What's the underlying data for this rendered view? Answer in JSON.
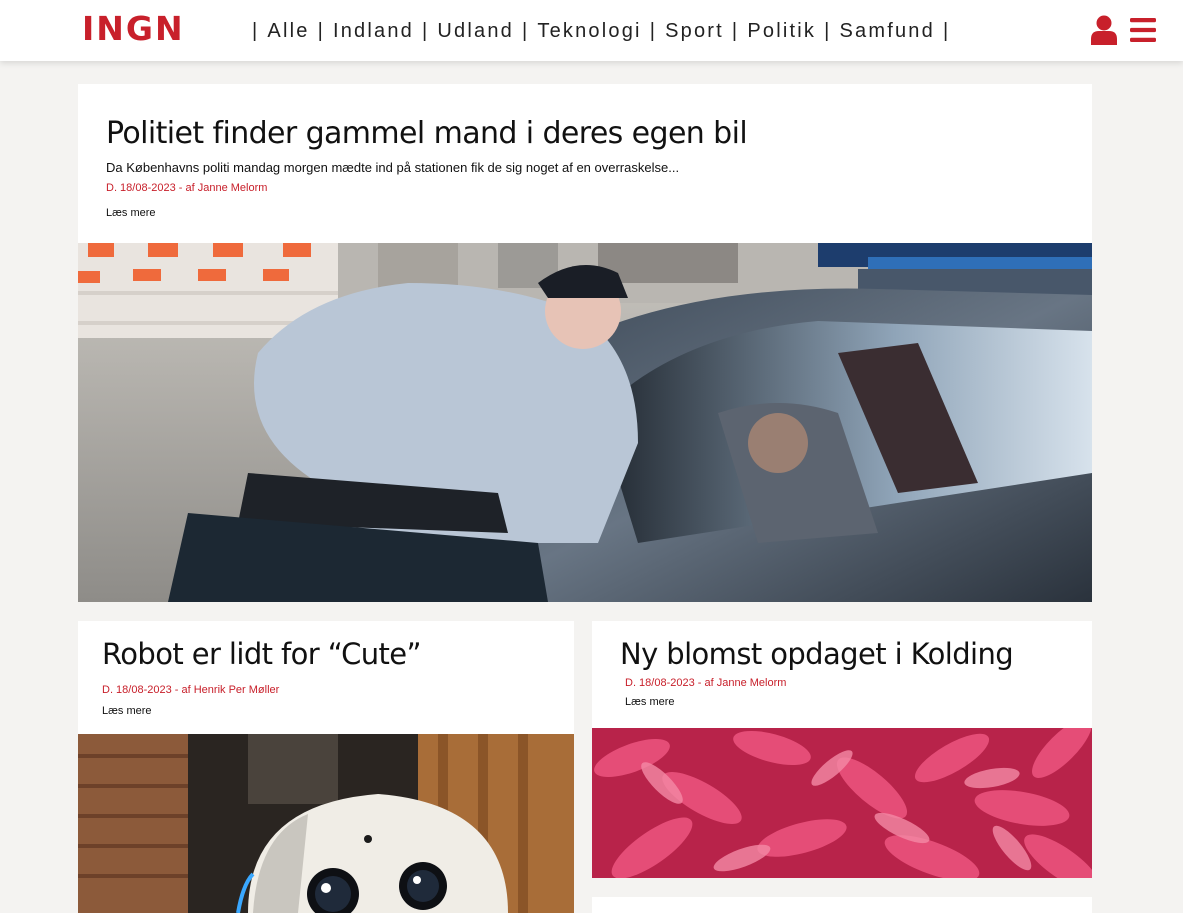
{
  "header": {
    "logo": "INGN",
    "nav": [
      {
        "label": "Alle"
      },
      {
        "label": "Indland"
      },
      {
        "label": "Udland"
      },
      {
        "label": "Teknologi"
      },
      {
        "label": "Sport"
      },
      {
        "label": "Politik"
      },
      {
        "label": "Samfund"
      }
    ],
    "separator": "|",
    "user_icon": "user-icon",
    "menu_icon": "hamburger-menu-icon"
  },
  "colors": {
    "accent": "#c8202b",
    "background": "#f4f3f1",
    "card": "#ffffff",
    "text": "#111111"
  },
  "articles": {
    "featured": {
      "title": "Politiet finder gammel mand i deres egen bil",
      "teaser": "Da Københavns politi mandag morgen mædte ind på stationen fik de sig noget af en overraskelse...",
      "meta": "D. 18/08-2023 - af Janne Melorm",
      "read_more": "Læs mere",
      "image": "police-officer-leaning-into-car-photo"
    },
    "robot": {
      "title": "Robot er lidt for “Cute”",
      "meta": "D. 18/08-2023 - af Henrik Per Møller",
      "read_more": "Læs mere",
      "image": "white-robot-photo"
    },
    "flower": {
      "title": "Ny blomst opdaget i Kolding",
      "meta": "D. 18/08-2023 - af Janne Melorm",
      "read_more": "Læs mere",
      "image": "pink-dahlia-flowers-photo"
    }
  }
}
